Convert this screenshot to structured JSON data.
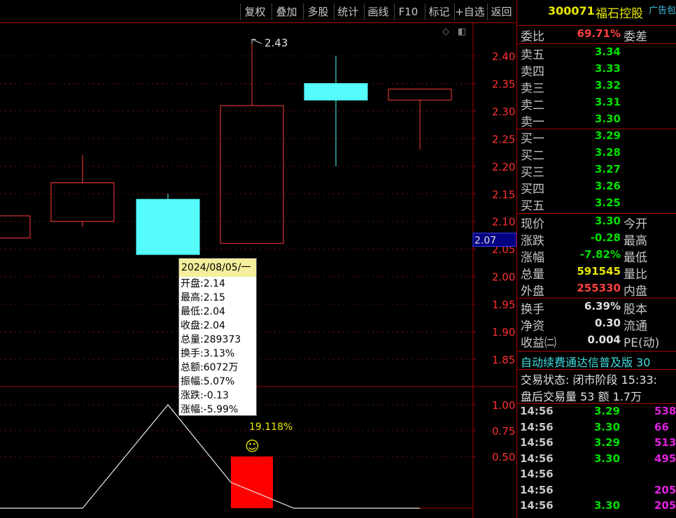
{
  "toolbar": {
    "buttons": [
      "复权",
      "叠加",
      "多股",
      "统计",
      "画线",
      "F10",
      "标记",
      "+自选",
      "返回"
    ]
  },
  "chart_data": {
    "type": "candlestick",
    "price_axis": {
      "ticks": [
        "2.40",
        "2.35",
        "2.30",
        "2.25",
        "2.20",
        "2.15",
        "2.10",
        "2.05",
        "2.00",
        "1.95",
        "1.90",
        "1.85"
      ],
      "range": [
        1.82,
        2.46
      ]
    },
    "candles": [
      {
        "open": 2.07,
        "close": 2.11,
        "high": 2.11,
        "low": 2.07,
        "color": "red",
        "hollow": true
      },
      {
        "open": 2.1,
        "close": 2.17,
        "high": 2.22,
        "low": 2.09,
        "color": "red",
        "hollow": true
      },
      {
        "open": 2.14,
        "close": 2.04,
        "high": 2.15,
        "low": 2.04,
        "color": "cyan",
        "hollow": false
      },
      {
        "open": 2.06,
        "close": 2.31,
        "high": 2.43,
        "low": 2.06,
        "color": "red",
        "hollow": true
      },
      {
        "open": 2.35,
        "close": 2.32,
        "high": 2.4,
        "low": 2.2,
        "color": "cyan",
        "hollow": false
      },
      {
        "open": 2.32,
        "close": 2.34,
        "high": 2.34,
        "low": 2.23,
        "color": "red",
        "hollow": true
      }
    ],
    "high_annotation": "2.43",
    "current_price_tag": "2.07",
    "indicator": {
      "ticks": [
        "1.00",
        "0.75",
        "0.50"
      ],
      "range": [
        0,
        1.0
      ],
      "line": [
        [
          0,
          0
        ],
        [
          1,
          0
        ],
        [
          2,
          1.0
        ],
        [
          3,
          0.25
        ],
        [
          4,
          0
        ],
        [
          5,
          0
        ]
      ],
      "bar": {
        "index": 3,
        "value": 0.5
      },
      "bar_label": "19.118%",
      "emoji": "☺"
    }
  },
  "tooltip": {
    "date": "2024/08/05/一",
    "rows": [
      "开盘:2.14",
      "最高:2.15",
      "最低:2.04",
      "收盘:2.04",
      "总量:289373",
      "换手:3.13%",
      "总额:6072万",
      "振幅:5.07%",
      "涨跌:-0.13",
      "涨幅:-5.99%"
    ]
  },
  "panel": {
    "code": "300071",
    "name": "福石控股",
    "ad": "广告包",
    "webi": {
      "label": "委比",
      "value": "69.71%",
      "label2": "委差"
    },
    "sell": [
      {
        "label": "卖五",
        "price": "3.34"
      },
      {
        "label": "卖四",
        "price": "3.33"
      },
      {
        "label": "卖三",
        "price": "3.32"
      },
      {
        "label": "卖二",
        "price": "3.31"
      },
      {
        "label": "卖一",
        "price": "3.30"
      }
    ],
    "buy": [
      {
        "label": "买一",
        "price": "3.29"
      },
      {
        "label": "买二",
        "price": "3.28"
      },
      {
        "label": "买三",
        "price": "3.27"
      },
      {
        "label": "买四",
        "price": "3.26"
      },
      {
        "label": "买五",
        "price": "3.25"
      }
    ],
    "quote": [
      {
        "label": "现价",
        "value": "3.30",
        "label2": "今开",
        "color": "green"
      },
      {
        "label": "涨跌",
        "value": "-0.28",
        "label2": "最高",
        "color": "green"
      },
      {
        "label": "涨幅",
        "value": "-7.82%",
        "label2": "最低",
        "color": "green"
      },
      {
        "label": "总量",
        "value": "591545",
        "label2": "量比",
        "color": "yellow"
      },
      {
        "label": "外盘",
        "value": "255330",
        "label2": "内盘",
        "color": "red"
      }
    ],
    "stats": [
      {
        "label": "换手",
        "value": "6.39%",
        "label2": "股本"
      },
      {
        "label": "净资",
        "value": "0.30",
        "label2": "流通"
      },
      {
        "label": "收益㈡",
        "value": "0.004",
        "label2": "PE(动)"
      }
    ],
    "banner1": "自动续费通达信普及版  30",
    "banner2": "交易状态: 闭市阶段 15:33:",
    "banner3": "盘后交易量 53 额 1.7万",
    "ticks": [
      {
        "time": "14:56",
        "price": "3.29",
        "vol": "538"
      },
      {
        "time": "14:56",
        "price": "3.30",
        "vol": "66"
      },
      {
        "time": "14:56",
        "price": "3.29",
        "vol": "513"
      },
      {
        "time": "14:56",
        "price": "3.30",
        "vol": "495"
      },
      {
        "time": "14:56",
        "price": "",
        "vol": ""
      },
      {
        "time": "14:56",
        "price": "",
        "vol": "205"
      },
      {
        "time": "14:56",
        "price": "3.30",
        "vol": "205"
      }
    ]
  }
}
